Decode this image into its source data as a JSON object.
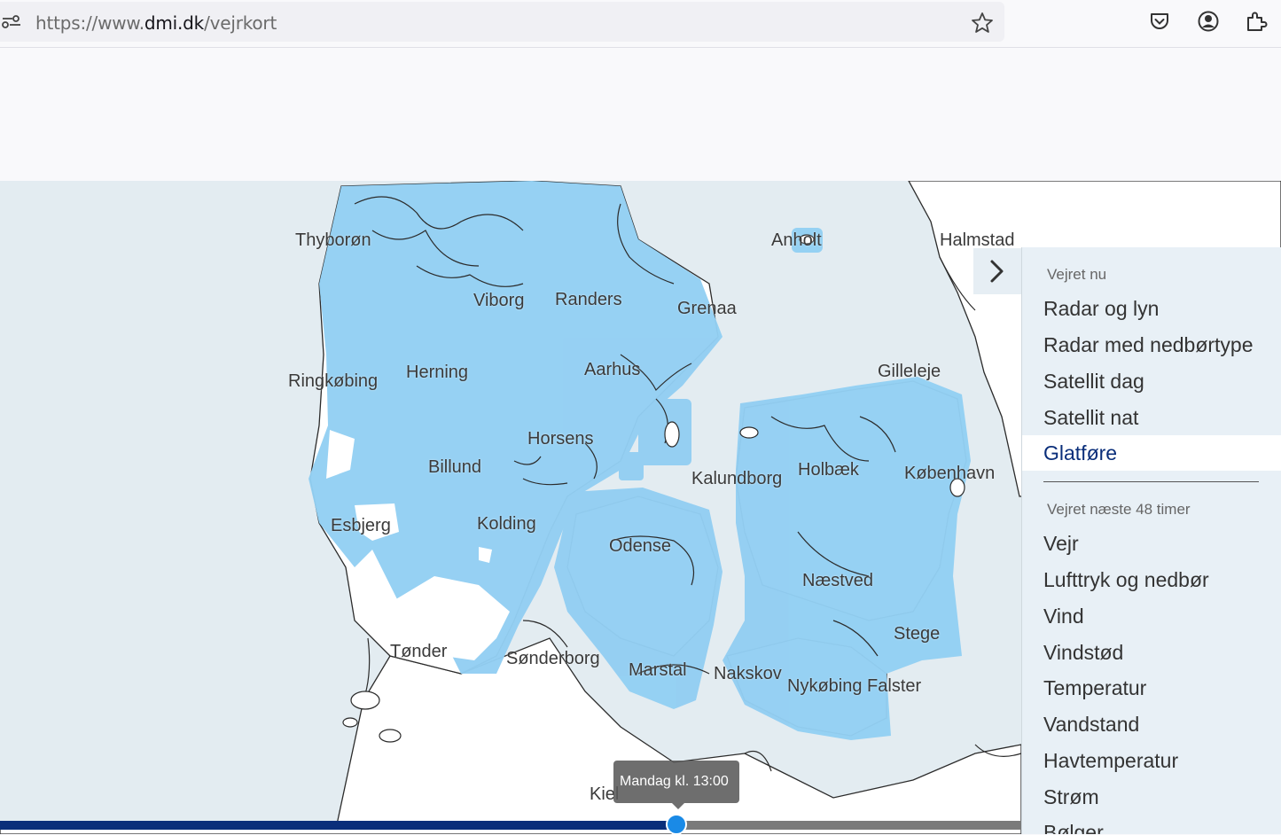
{
  "browser": {
    "url_prefix": "https://www.",
    "url_host": "dmi.dk",
    "url_path": "/vejrkort",
    "icons": [
      "page-info-icon",
      "bookmark-star-icon",
      "pocket-icon",
      "account-icon",
      "extensions-icon"
    ]
  },
  "map": {
    "cities": [
      {
        "name": "Thyborøn"
      },
      {
        "name": "Anholt"
      },
      {
        "name": "Halmstad"
      },
      {
        "name": "Viborg"
      },
      {
        "name": "Randers"
      },
      {
        "name": "Grenaa"
      },
      {
        "name": "Ringkøbing"
      },
      {
        "name": "Herning"
      },
      {
        "name": "Aarhus"
      },
      {
        "name": "Gilleleje"
      },
      {
        "name": "Horsens"
      },
      {
        "name": "Billund"
      },
      {
        "name": "Holbæk"
      },
      {
        "name": "Kalundborg"
      },
      {
        "name": "København"
      },
      {
        "name": "Esbjerg"
      },
      {
        "name": "Kolding"
      },
      {
        "name": "Odense"
      },
      {
        "name": "Næstved"
      },
      {
        "name": "Stege"
      },
      {
        "name": "Tønder"
      },
      {
        "name": "Sønderborg"
      },
      {
        "name": "Marstal"
      },
      {
        "name": "Nakskov"
      },
      {
        "name": "Nykøbing Falster"
      },
      {
        "name": "Kiel"
      }
    ],
    "colors": {
      "sea": "#e3ecf1",
      "land": "#ffffff",
      "coverage": "#93cff3",
      "coast": "#2b2b2b"
    }
  },
  "timeline": {
    "tooltip": "Mandag kl. 13:00",
    "progress": 0.662,
    "colors": {
      "fill": "#0a2e7a",
      "track": "#7a7a7a",
      "knob": "#1a8ae6"
    }
  },
  "panel": {
    "toggle_icon": "chevron-right-icon",
    "section_now": "Vejret nu",
    "items_now": [
      "Radar og lyn",
      "Radar med nedbørtype",
      "Satellit dag",
      "Satellit nat",
      "Glatføre"
    ],
    "active_item": "Glatføre",
    "section_next": "Vejret næste 48 timer",
    "items_next": [
      "Vejr",
      "Lufttryk og nedbør",
      "Vind",
      "Vindstød",
      "Temperatur",
      "Vandstand",
      "Havtemperatur",
      "Strøm",
      "Bølger"
    ],
    "colors": {
      "background": "#e8f0f6",
      "active_text": "#0a2e7a"
    }
  }
}
